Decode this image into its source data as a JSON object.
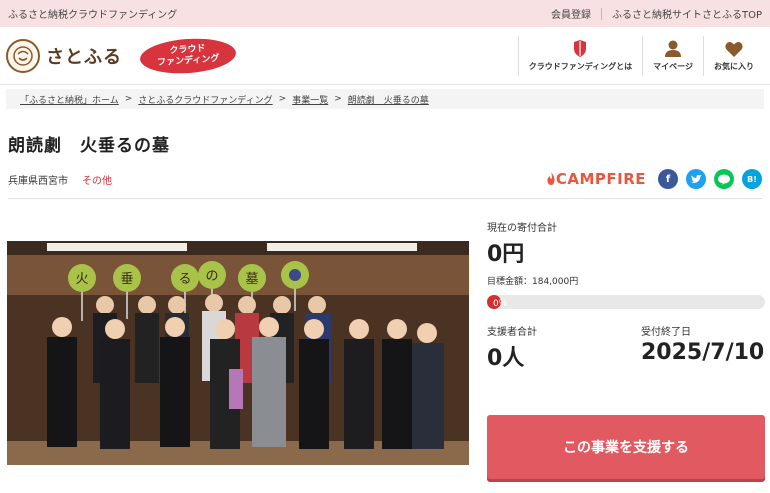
{
  "topbar": {
    "site_name": "ふるさと納税クラウドファンディング",
    "register": "会員登録",
    "top_link": "ふるさと納税サイトさとふるTOP"
  },
  "header": {
    "logo_mark": "さと\nふる",
    "logo_text": "さとふる",
    "badge_line1": "クラウド",
    "badge_line2": "ファンディング",
    "nav": [
      {
        "label": "クラウドファンディングとは",
        "icon": "shield-icon"
      },
      {
        "label": "マイページ",
        "icon": "person-icon"
      },
      {
        "label": "お気に入り",
        "icon": "heart-icon"
      }
    ]
  },
  "breadcrumb": [
    "「ふるさと納税」ホーム",
    "さとふるクラウドファンディング",
    "事業一覧",
    "朗読劇　火垂るの墓"
  ],
  "project": {
    "title": "朗読劇　火垂るの墓",
    "location": "兵庫県西宮市",
    "category": "その他",
    "platform": "CAMPFIRE"
  },
  "share": [
    {
      "name": "facebook-icon",
      "glyph": "f",
      "color": "#3b5998"
    },
    {
      "name": "twitter-icon",
      "glyph": "t",
      "color": "#1da1f2"
    },
    {
      "name": "line-icon",
      "glyph": "L",
      "color": "#06c755"
    },
    {
      "name": "hatena-bookmark-icon",
      "glyph": "B!",
      "color": "#00a4de"
    }
  ],
  "photo": {
    "signs": [
      "火",
      "垂",
      "る",
      "の",
      "墓"
    ]
  },
  "funding": {
    "current_label": "現在の寄付合計",
    "current_value": "0円",
    "goal_text": "目標金額：184,000円",
    "progress_text": "0％",
    "progress_fraction": 0,
    "supporters_label": "支援者合計",
    "supporters_value": "0人",
    "deadline_label": "受付終了日",
    "deadline_value": "2025/7/10",
    "support_button": "この事業を支援する"
  },
  "colors": {
    "accent": "#d8343d",
    "button": "#e15a62",
    "topbar_bg": "#f8e1e3",
    "campfire": "#e8573d"
  }
}
